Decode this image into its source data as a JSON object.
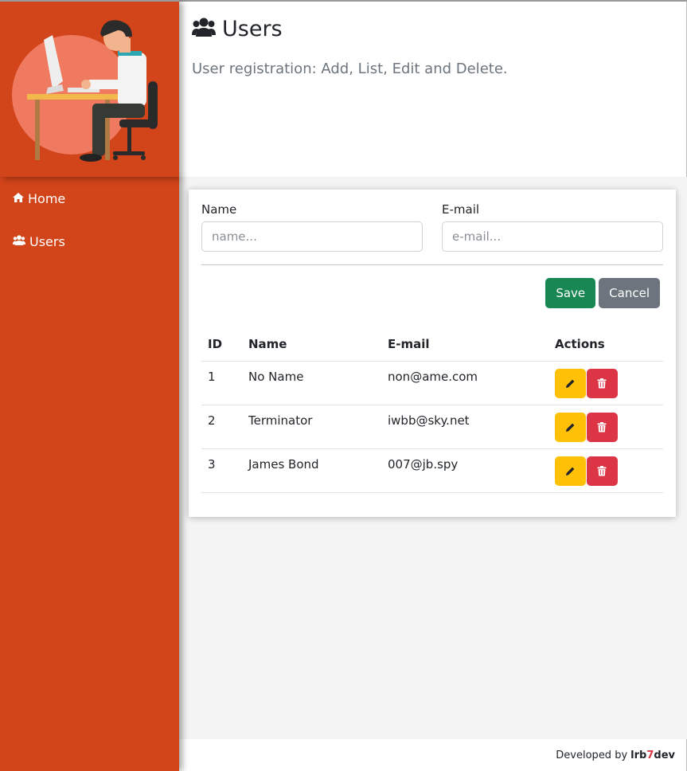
{
  "header": {
    "title": "Users",
    "subtitle": "User registration: Add, List, Edit and Delete."
  },
  "menu": {
    "items": [
      {
        "label": "Home",
        "icon": "home-icon"
      },
      {
        "label": "Users",
        "icon": "users-icon"
      }
    ]
  },
  "form": {
    "name_label": "Name",
    "name_placeholder": "name...",
    "email_label": "E-mail",
    "email_placeholder": "e-mail...",
    "save_label": "Save",
    "cancel_label": "Cancel"
  },
  "table": {
    "columns": [
      "ID",
      "Name",
      "E-mail",
      "Actions"
    ],
    "rows": [
      {
        "id": "1",
        "name": "No Name",
        "email": "non@ame.com"
      },
      {
        "id": "2",
        "name": "Terminator",
        "email": "iwbb@sky.net"
      },
      {
        "id": "3",
        "name": "James Bond",
        "email": "007@jb.spy"
      }
    ]
  },
  "footer": {
    "text": "Developed by",
    "brand_prefix": "lrb",
    "brand_accent": "7",
    "brand_suffix": "dev"
  },
  "colors": {
    "sidebar": "#d24419",
    "save": "#198754",
    "cancel": "#6c757d",
    "edit": "#ffc107",
    "delete": "#dc3545"
  }
}
